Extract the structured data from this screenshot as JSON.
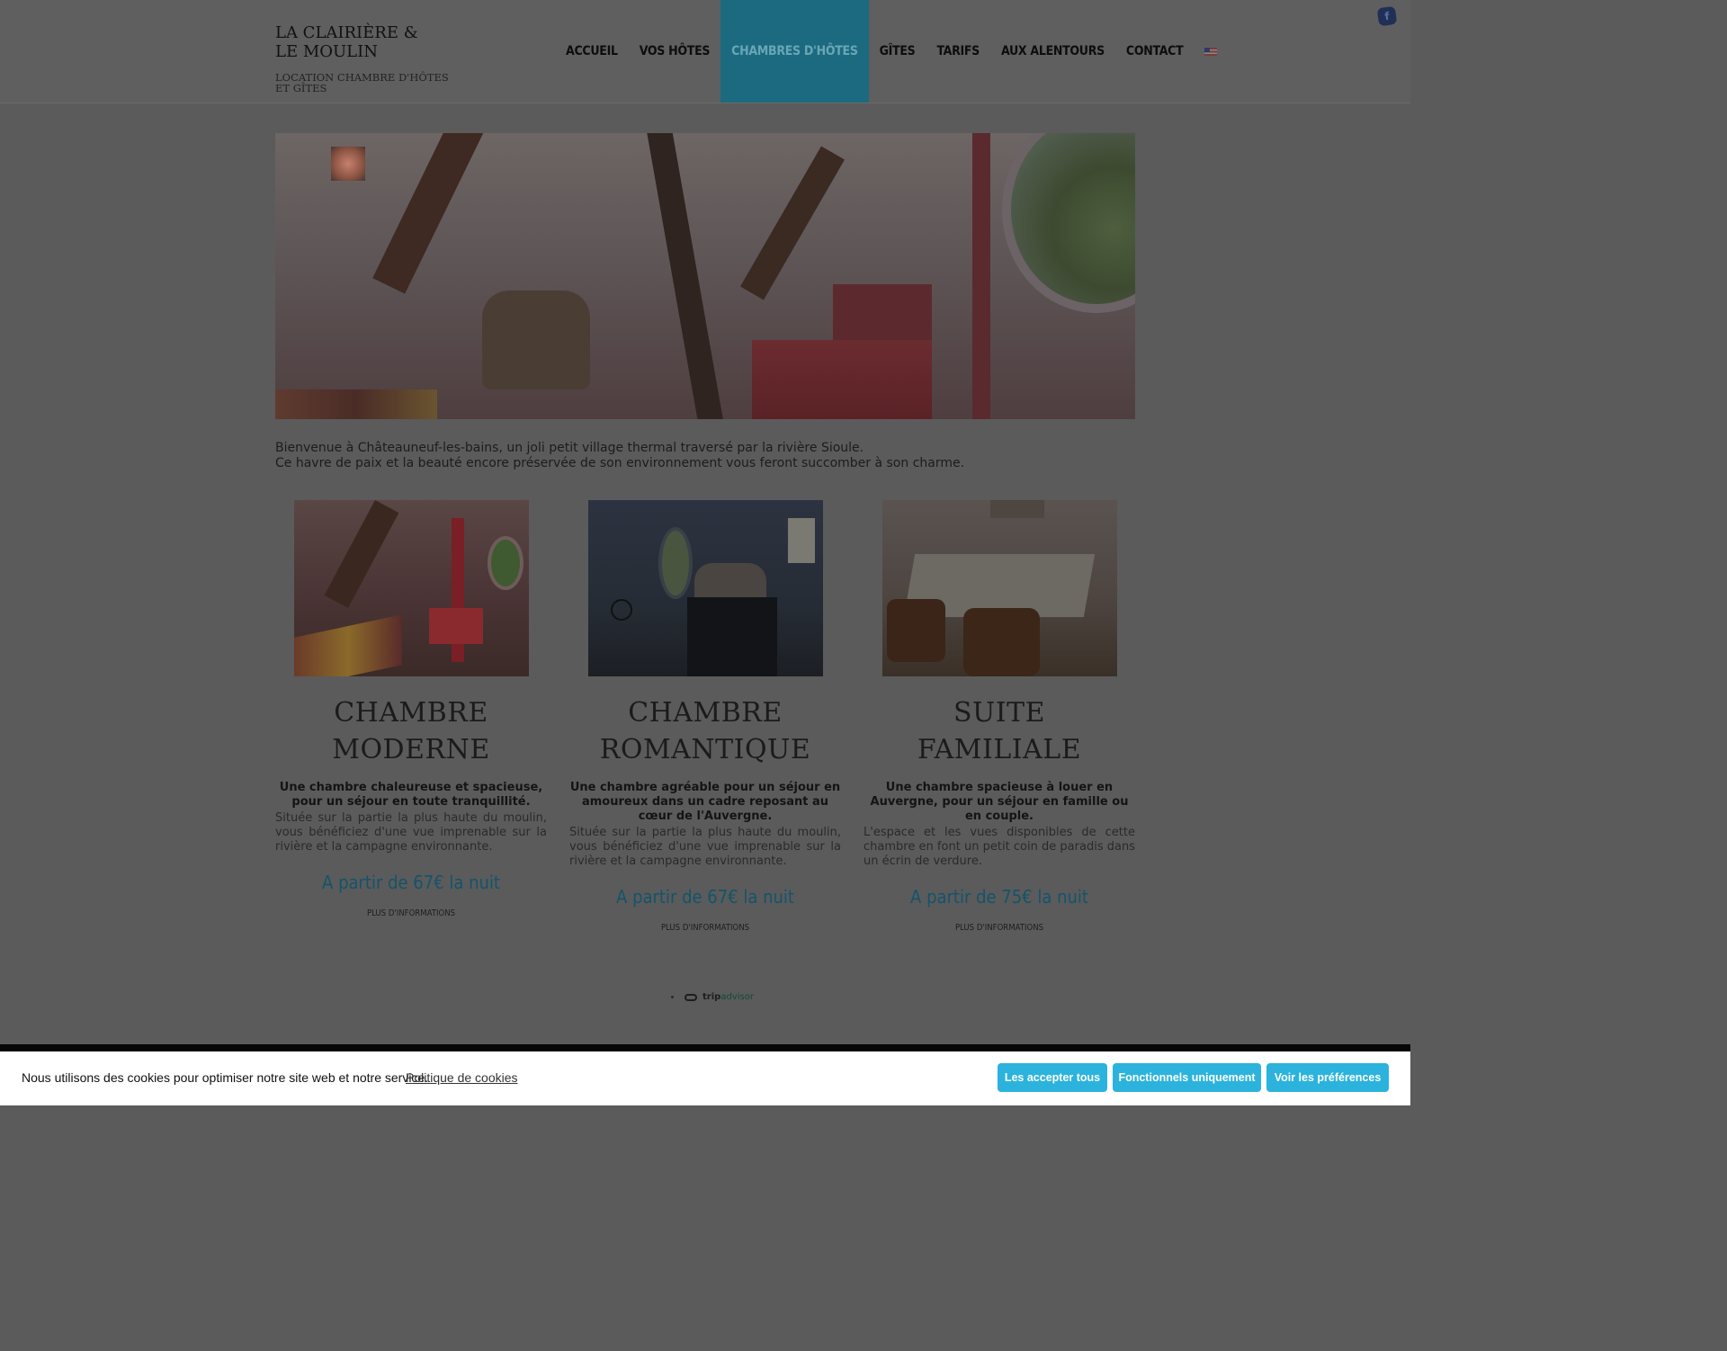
{
  "site": {
    "title_line1": "LA CLAIRIÈRE &",
    "title_line2": "LE MOULIN",
    "subtitle_line1": "LOCATION CHAMBRE D'HÔTES",
    "subtitle_line2": "ET GÎTES"
  },
  "nav": {
    "items": [
      {
        "label": "ACCUEIL"
      },
      {
        "label": "VOS HÔTES"
      },
      {
        "label": "CHAMBRES D'HÔTES",
        "active": true
      },
      {
        "label": "GÎTES"
      },
      {
        "label": "TARIFS"
      },
      {
        "label": "AUX ALENTOURS"
      },
      {
        "label": "CONTACT"
      }
    ],
    "language_flag": "us-flag-icon",
    "social_icon": "facebook-icon",
    "social_label": "f"
  },
  "intro": {
    "line1": "Bienvenue à Châteauneuf-les-bains, un joli petit village thermal traversé par la rivière Sioule.",
    "line2": "Ce havre de paix et la beauté encore préservée de son environnement vous feront succomber à son charme."
  },
  "rooms": [
    {
      "title_line1": "CHAMBRE",
      "title_line2": "MODERNE",
      "lead": "Une chambre chaleureuse et spacieuse, pour un séjour en toute tranquillité.",
      "text": "Située sur la partie la plus haute du moulin, vous bénéficiez d'une vue imprenable sur la rivière et la campagne environnante.",
      "price": "A partir de 67€ la nuit",
      "more": "PLUS D'INFORMATIONS"
    },
    {
      "title_line1": "CHAMBRE",
      "title_line2": "ROMANTIQUE",
      "lead": "Une chambre agréable pour un séjour en amoureux dans un cadre reposant au cœur de l'Auvergne.",
      "text": "Située sur la partie la plus haute du moulin, vous bénéficiez d'une vue imprenable sur la rivière et la campagne environnante.",
      "price": "A partir de 67€ la nuit",
      "more": "PLUS D'INFORMATIONS"
    },
    {
      "title_line1": "SUITE",
      "title_line2": "FAMILIALE",
      "lead": "Une chambre spacieuse à louer en Auvergne, pour un séjour en famille ou en couple.",
      "text": "L'espace et les vues disponibles de cette chambre en font un petit coin de paradis dans un écrin de verdure.",
      "price": "A partir de 75€ la nuit",
      "more": "PLUS D'INFORMATIONS"
    }
  ],
  "tripadvisor": {
    "brand_prefix": "trip",
    "brand_suffix": "advisor"
  },
  "cookie_banner": {
    "message": "Nous utilisons des cookies pour optimiser notre site web et notre service.",
    "policy_link": "Politique de cookies",
    "accept_all": "Les accepter tous",
    "functional_only": "Fonctionnels uniquement",
    "preferences": "Voir les préférences",
    "button_color": "#2bb3dd"
  },
  "colors": {
    "nav_active_bg": "#1b6a80",
    "price_color": "#14546a"
  }
}
